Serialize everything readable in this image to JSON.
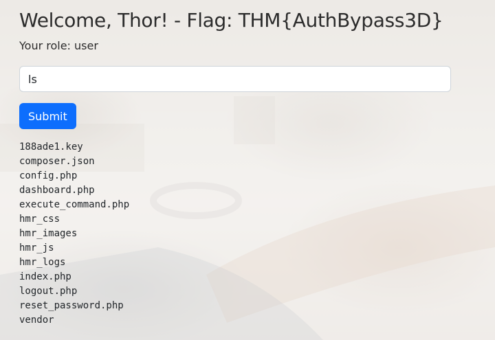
{
  "header": {
    "welcome": "Welcome, Thor! - Flag: THM{AuthBypass3D}",
    "role": "Your role: user"
  },
  "form": {
    "command_value": "ls",
    "submit_label": "Submit"
  },
  "output": {
    "files": [
      "188ade1.key",
      "composer.json",
      "config.php",
      "dashboard.php",
      "execute_command.php",
      "hmr_css",
      "hmr_images",
      "hmr_js",
      "hmr_logs",
      "index.php",
      "logout.php",
      "reset_password.php",
      "vendor"
    ]
  },
  "colors": {
    "primary": "#0d6efd",
    "text": "#212529"
  }
}
